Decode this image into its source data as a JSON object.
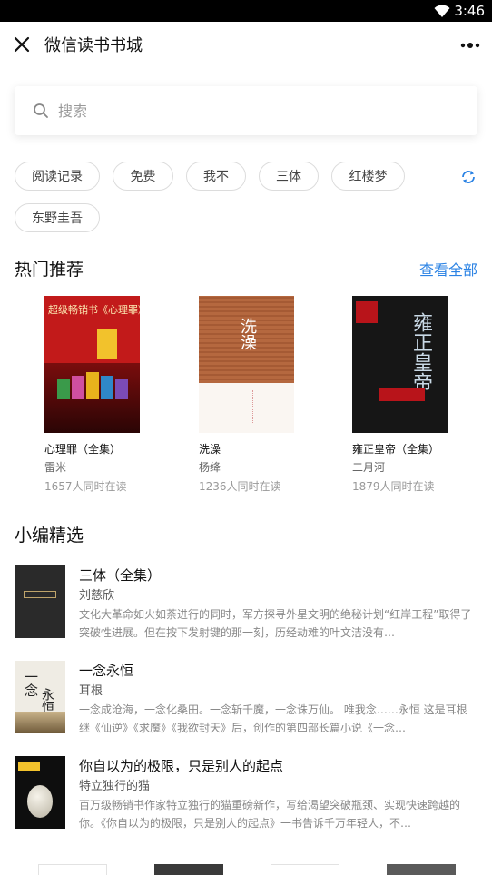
{
  "status": {
    "time": "3:46"
  },
  "header": {
    "title": "微信读书书城",
    "close_icon": "close-icon",
    "more_icon": "more-dots-icon"
  },
  "search": {
    "placeholder": "搜索",
    "value": ""
  },
  "chips": [
    "阅读记录",
    "免费",
    "我不",
    "三体",
    "红楼梦",
    "东野圭吾"
  ],
  "hot": {
    "title": "热门推荐",
    "see_all": "查看全部",
    "books": [
      {
        "name": "心理罪（全集）",
        "author": "雷米",
        "readers": "1657人同时在读",
        "cover_text": "超级畅销书《心理罪》",
        "cover_color": "#c21a1a"
      },
      {
        "name": "洗澡",
        "author": "杨绛",
        "readers": "1236人同时在读",
        "cover_text": "洗澡",
        "cover_color": "#b0653d"
      },
      {
        "name": "雍正皇帝（全集）",
        "author": "二月河",
        "readers": "1879人同时在读",
        "cover_text": "雍正皇帝",
        "cover_color": "#161616"
      }
    ]
  },
  "picks": {
    "title": "小编精选",
    "items": [
      {
        "title": "三体（全集）",
        "author": "刘慈欣",
        "desc": "文化大革命如火如荼进行的同时，军方探寻外星文明的绝秘计划“红岸工程”取得了突破性进展。但在按下发射键的那一刻，历经劫难的叶文洁没有…"
      },
      {
        "title": "一念永恒",
        "author": "耳根",
        "desc": "一念成沧海，一念化桑田。一念斩千魔，一念诛万仙。 唯我念……永恒 这是耳根继《仙逆》《求魔》《我欲封天》后，创作的第四部长篇小说《一念…"
      },
      {
        "title": "你自以为的极限，只是别人的起点",
        "author": "特立独行的猫",
        "desc": "百万级畅销书作家特立独行的猫重磅新作，写给渴望突破瓶颈、实现快速跨越的你。《你自以为的极限，只是别人的起点》一书告诉千万年轻人，不…"
      }
    ]
  },
  "colors": {
    "accent": "#2a82e4"
  }
}
